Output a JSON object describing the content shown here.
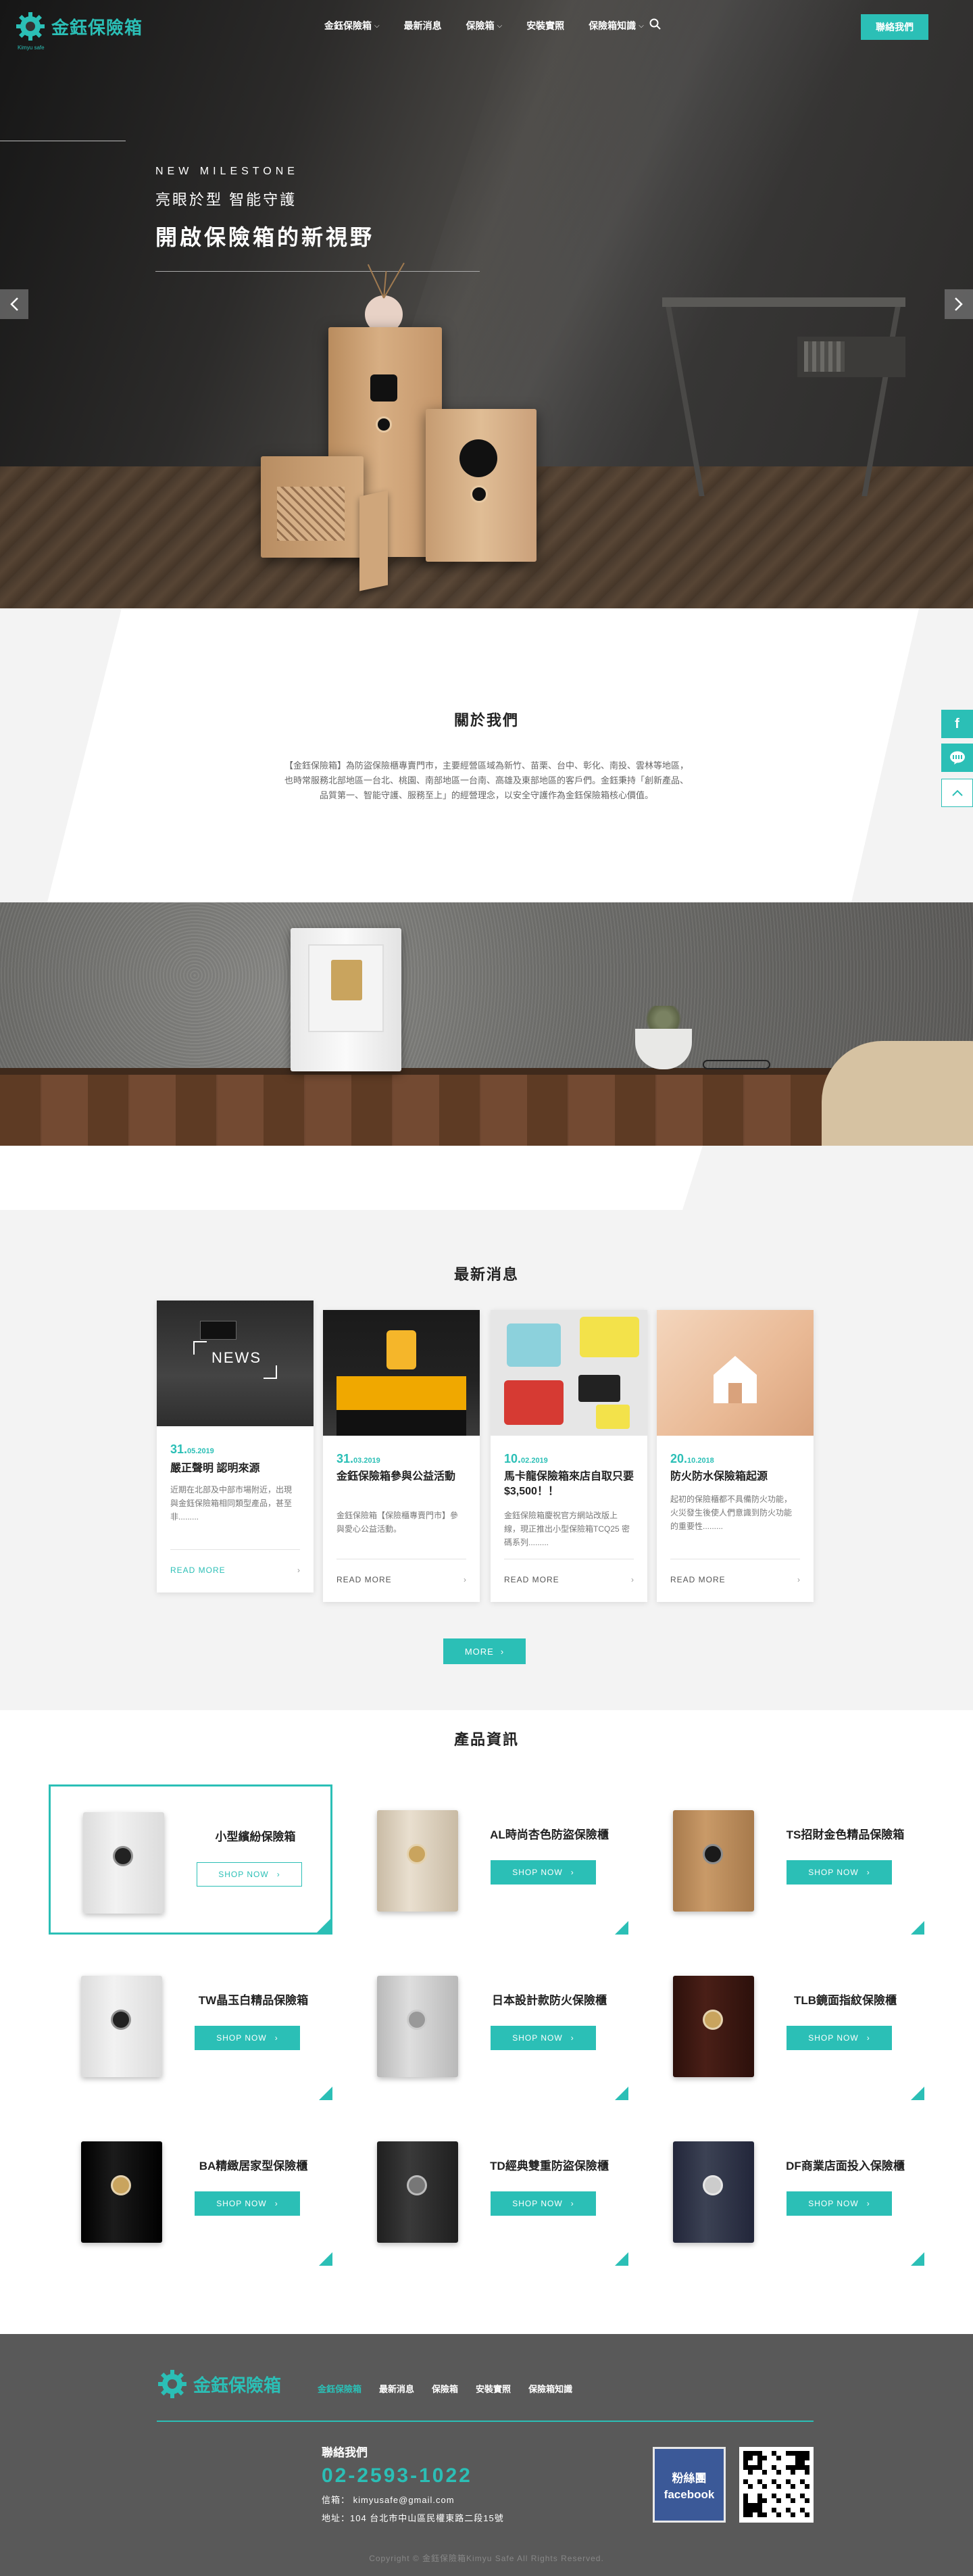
{
  "header": {
    "logo_text": "金鈺保險箱",
    "logo_sub": "Kimyu safe",
    "nav": [
      {
        "label": "金鈺保險箱",
        "has_dropdown": true
      },
      {
        "label": "最新消息",
        "has_dropdown": false
      },
      {
        "label": "保險箱",
        "has_dropdown": true
      },
      {
        "label": "安裝實照",
        "has_dropdown": false
      },
      {
        "label": "保險箱知識",
        "has_dropdown": true
      }
    ],
    "search_icon": "search-icon",
    "contact_label": "聯絡我們"
  },
  "hero": {
    "kicker": "NEW MILESTONE",
    "subtitle": "亮眼於型 智能守護",
    "title": "開啟保險箱的新視野",
    "prev_icon": "chevron-left-icon",
    "next_icon": "chevron-right-icon"
  },
  "about": {
    "title": "關於我們",
    "text_line1": "【金鈺保險箱】為防盜保險櫃專賣門市，主要經營區域為新竹、苗栗、台中、彰化、南投、雲林等地區，",
    "text_line2": "也時常服務北部地區一台北、桃園、南部地區一台南、高雄及東部地區的客戶們。金鈺秉持「創新產品、",
    "text_line3": "品質第一、智能守護、服務至上」的經營理念，以安全守護作為金鈺保險箱核心價值。"
  },
  "news": {
    "title": "最新消息",
    "more_label": "MORE",
    "items": [
      {
        "day": "31.",
        "month_year": "05.2019",
        "title": "嚴正聲明 認明來源",
        "desc": "近期在北部及中部市場附近，出現與金鈺保險箱相同類型產品，甚至非.........",
        "more": "READ MORE",
        "img_label": "NEWS"
      },
      {
        "day": "31.",
        "month_year": "03.2019",
        "title": "金鈺保險箱參與公益活動",
        "desc": "金鈺保險箱【保險櫃專賣門市】參與愛心公益活動。",
        "more": "READ MORE",
        "img_label": ""
      },
      {
        "day": "10.",
        "month_year": "02.2019",
        "title": "馬卡龍保險箱來店自取只要$3,500！！",
        "desc": "金鈺保險箱慶祝官方網站改版上線，現正推出小型保險箱TCQ25 密碼系列.........",
        "more": "READ MORE",
        "img_label": ""
      },
      {
        "day": "20.",
        "month_year": "10.2018",
        "title": "防火防水保險箱起源",
        "desc": "起初的保險櫃都不具備防火功能，火災發生後使人們意識到防火功能的重要性.........",
        "more": "READ MORE",
        "img_label": ""
      }
    ]
  },
  "products": {
    "title": "產品資訊",
    "shop_label": "SHOP NOW",
    "items": [
      {
        "name": "小型繽紛保險箱",
        "style": "white"
      },
      {
        "name": "AL時尚杏色防盜保險櫃",
        "style": "beige"
      },
      {
        "name": "TS招財金色精品保險箱",
        "style": "gold"
      },
      {
        "name": "TW晶玉白精品保險箱",
        "style": "white"
      },
      {
        "name": "日本設計款防火保險櫃",
        "style": "silver"
      },
      {
        "name": "TLB鏡面指紋保險櫃",
        "style": "brown"
      },
      {
        "name": "BA精緻居家型保險櫃",
        "style": "black"
      },
      {
        "name": "TD經典雙重防盜保險櫃",
        "style": "darkgrey"
      },
      {
        "name": "DF商業店面投入保險櫃",
        "style": "navy"
      }
    ]
  },
  "side": {
    "facebook_icon": "facebook-icon",
    "line_icon": "line-icon",
    "top_icon": "arrow-up-icon",
    "facebook_label": "f"
  },
  "footer": {
    "logo_text": "金鈺保險箱",
    "nav": [
      "金鈺保險箱",
      "最新消息",
      "保險箱",
      "安裝實照",
      "保險箱知識"
    ],
    "contact_title": "聯絡我們",
    "phone": "02-2593-1022",
    "email": "信箱： kimyusafe@gmail.com",
    "address": "地址：104 台北市中山區民權東路二段15號",
    "fans_line1": "粉絲團",
    "fans_line2": "facebook",
    "copyright": "Copyright © 金鈺保險箱Kimyu Safe All Rights Reserved."
  },
  "colors": {
    "accent": "#2bbfb6",
    "footer_bg": "#595959",
    "section_bg": "#f3f3f3"
  }
}
